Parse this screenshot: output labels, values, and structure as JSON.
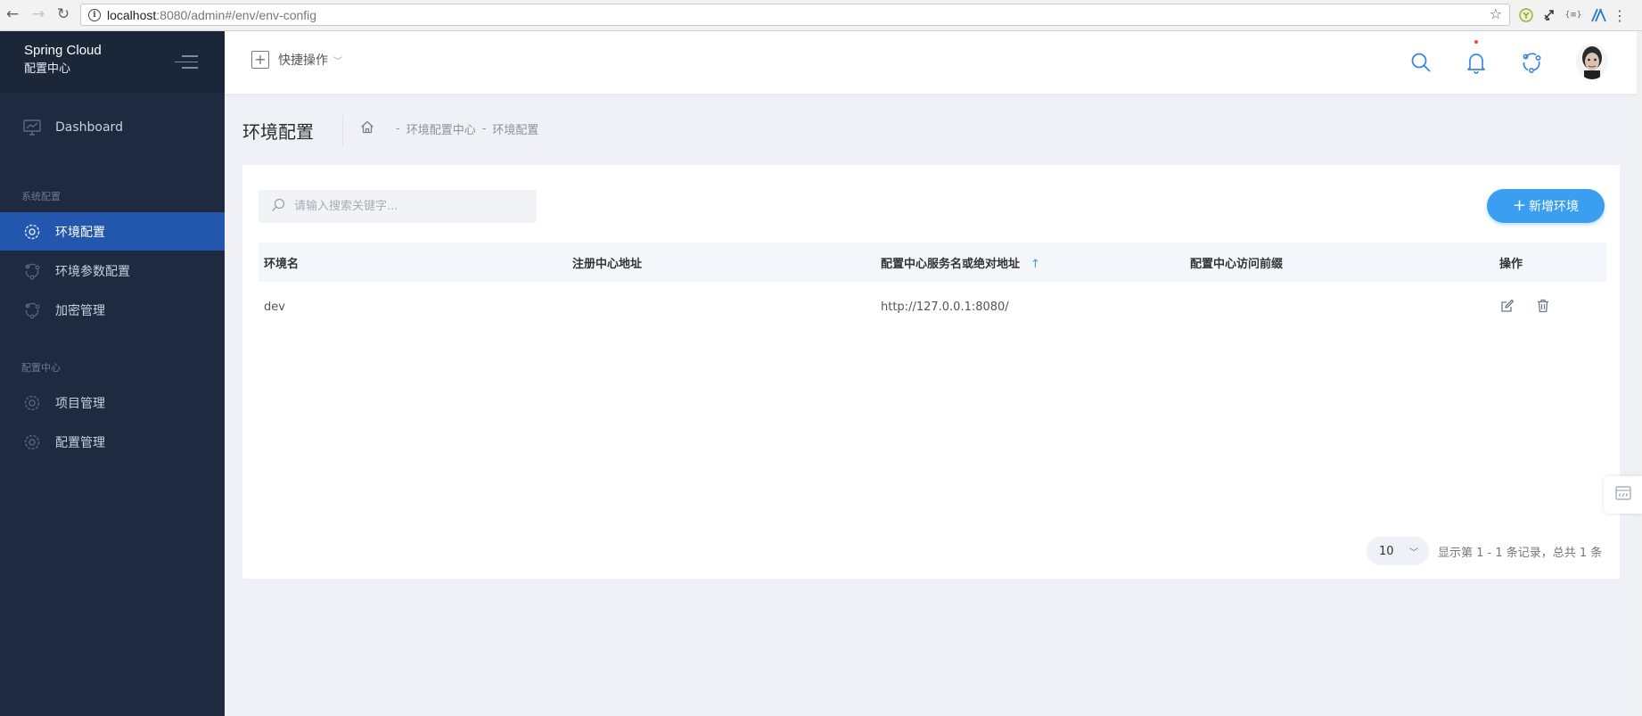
{
  "browser": {
    "url_host": "localhost",
    "url_path": ":8080/admin#/env/env-config"
  },
  "sidebar": {
    "brand_title": "Spring Cloud",
    "brand_subtitle": "配置中心",
    "dashboard_label": "Dashboard",
    "groups": [
      {
        "title": "系统配置",
        "items": [
          "环境配置",
          "环境参数配置",
          "加密管理"
        ]
      },
      {
        "title": "配置中心",
        "items": [
          "项目管理",
          "配置管理"
        ]
      }
    ],
    "active_item": "环境配置"
  },
  "topbar": {
    "quick_actions_label": "快捷操作"
  },
  "page": {
    "title": "环境配置",
    "breadcrumb": [
      "环境配置中心",
      "环境配置"
    ]
  },
  "search": {
    "placeholder": "请输入搜索关键字..."
  },
  "add_button_label": "新增环境",
  "table": {
    "columns": [
      "环境名",
      "注册中心地址",
      "配置中心服务名或绝对地址",
      "配置中心访问前缀",
      "操作"
    ],
    "rows": [
      {
        "env_name": "dev",
        "registry": "",
        "config_server": "http://127.0.0.1:8080/",
        "prefix": ""
      }
    ]
  },
  "pagination": {
    "page_size": "10",
    "summary": "显示第 1 - 1 条记录，总共 1 条"
  },
  "colors": {
    "sidebar_bg": "#1d2a40",
    "active_item_bg": "#2356ad",
    "primary": "#3a9ff0"
  }
}
